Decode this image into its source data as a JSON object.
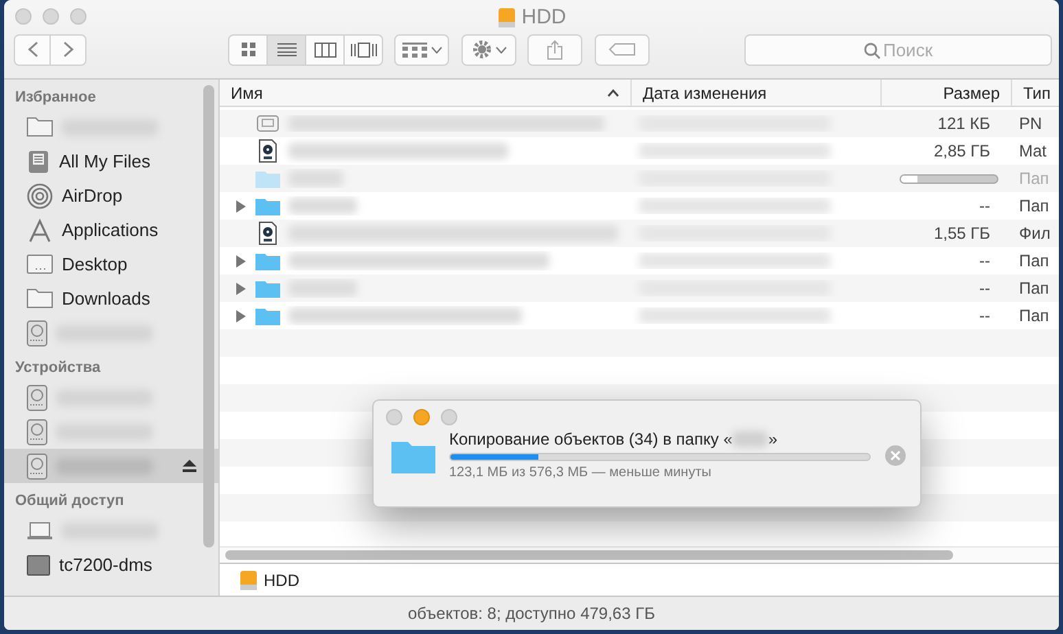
{
  "window": {
    "title": "HDD"
  },
  "toolbar": {
    "view_modes": [
      {
        "kind": "icons",
        "selected": false
      },
      {
        "kind": "list",
        "selected": true
      },
      {
        "kind": "columns",
        "selected": false
      },
      {
        "kind": "coverflow",
        "selected": false
      }
    ],
    "search": {
      "placeholder": "Поиск"
    }
  },
  "sidebar": {
    "sections": [
      {
        "title": "Избранное",
        "items": [
          {
            "kind": "folder",
            "redacted": true,
            "selected": false,
            "ejectable": false
          },
          {
            "kind": "files",
            "label": "All My Files",
            "selected": false,
            "ejectable": false
          },
          {
            "kind": "airdrop",
            "label": "AirDrop",
            "selected": false,
            "ejectable": false
          },
          {
            "kind": "apps",
            "label": "Applications",
            "selected": false,
            "ejectable": false
          },
          {
            "kind": "desktop",
            "label": "Desktop",
            "selected": false,
            "ejectable": false
          },
          {
            "kind": "folder",
            "label": "Downloads",
            "selected": false,
            "ejectable": false
          },
          {
            "kind": "drive",
            "redacted": true,
            "selected": false,
            "ejectable": false
          }
        ]
      },
      {
        "title": "Устройства",
        "items": [
          {
            "kind": "drive",
            "redacted": true,
            "selected": false,
            "ejectable": false
          },
          {
            "kind": "drive",
            "redacted": true,
            "selected": false,
            "ejectable": false
          },
          {
            "kind": "drive",
            "redacted": true,
            "selected": true,
            "ejectable": true
          }
        ]
      },
      {
        "title": "Общий доступ",
        "items": [
          {
            "kind": "laptop",
            "redacted": true,
            "selected": false,
            "ejectable": false
          },
          {
            "kind": "display",
            "label": "tc7200-dms",
            "selected": false,
            "ejectable": false
          }
        ]
      }
    ]
  },
  "table": {
    "columns": [
      {
        "label": "Имя",
        "sorted": true
      },
      {
        "label": "Дата изменения",
        "sorted": false
      },
      {
        "label": "Размер",
        "sorted": false
      },
      {
        "label": "Тип",
        "sorted": false
      }
    ],
    "rows": [
      {
        "kind": "image",
        "expandable": false,
        "copying": false,
        "size": "121 КБ",
        "type": "PN"
      },
      {
        "kind": "disk-image",
        "expandable": false,
        "copying": false,
        "size": "2,85 ГБ",
        "type": "Mat"
      },
      {
        "kind": "folder",
        "expandable": false,
        "copying": true,
        "level": 0.17,
        "type": "Пап"
      },
      {
        "kind": "folder",
        "expandable": true,
        "copying": false,
        "size": "--",
        "type": "Пап"
      },
      {
        "kind": "disk-image",
        "expandable": false,
        "copying": false,
        "size": "1,55 ГБ",
        "type": "Фил"
      },
      {
        "kind": "folder",
        "expandable": true,
        "copying": false,
        "size": "--",
        "type": "Пап"
      },
      {
        "kind": "folder",
        "expandable": true,
        "copying": false,
        "size": "--",
        "type": "Пап"
      },
      {
        "kind": "folder",
        "expandable": true,
        "copying": false,
        "size": "--",
        "type": "Пап"
      }
    ]
  },
  "path_bar": {
    "items": [
      {
        "label": "HDD"
      }
    ]
  },
  "status_bar": "объектов: 8; доступно 479,63 ГБ",
  "copy_dialog": {
    "title_prefix": "Копирование объектов (34) в папку «",
    "title_suffix": "»",
    "level": 0.21,
    "detail": "123,1 МБ из 576,3 МБ — меньше минуты"
  }
}
